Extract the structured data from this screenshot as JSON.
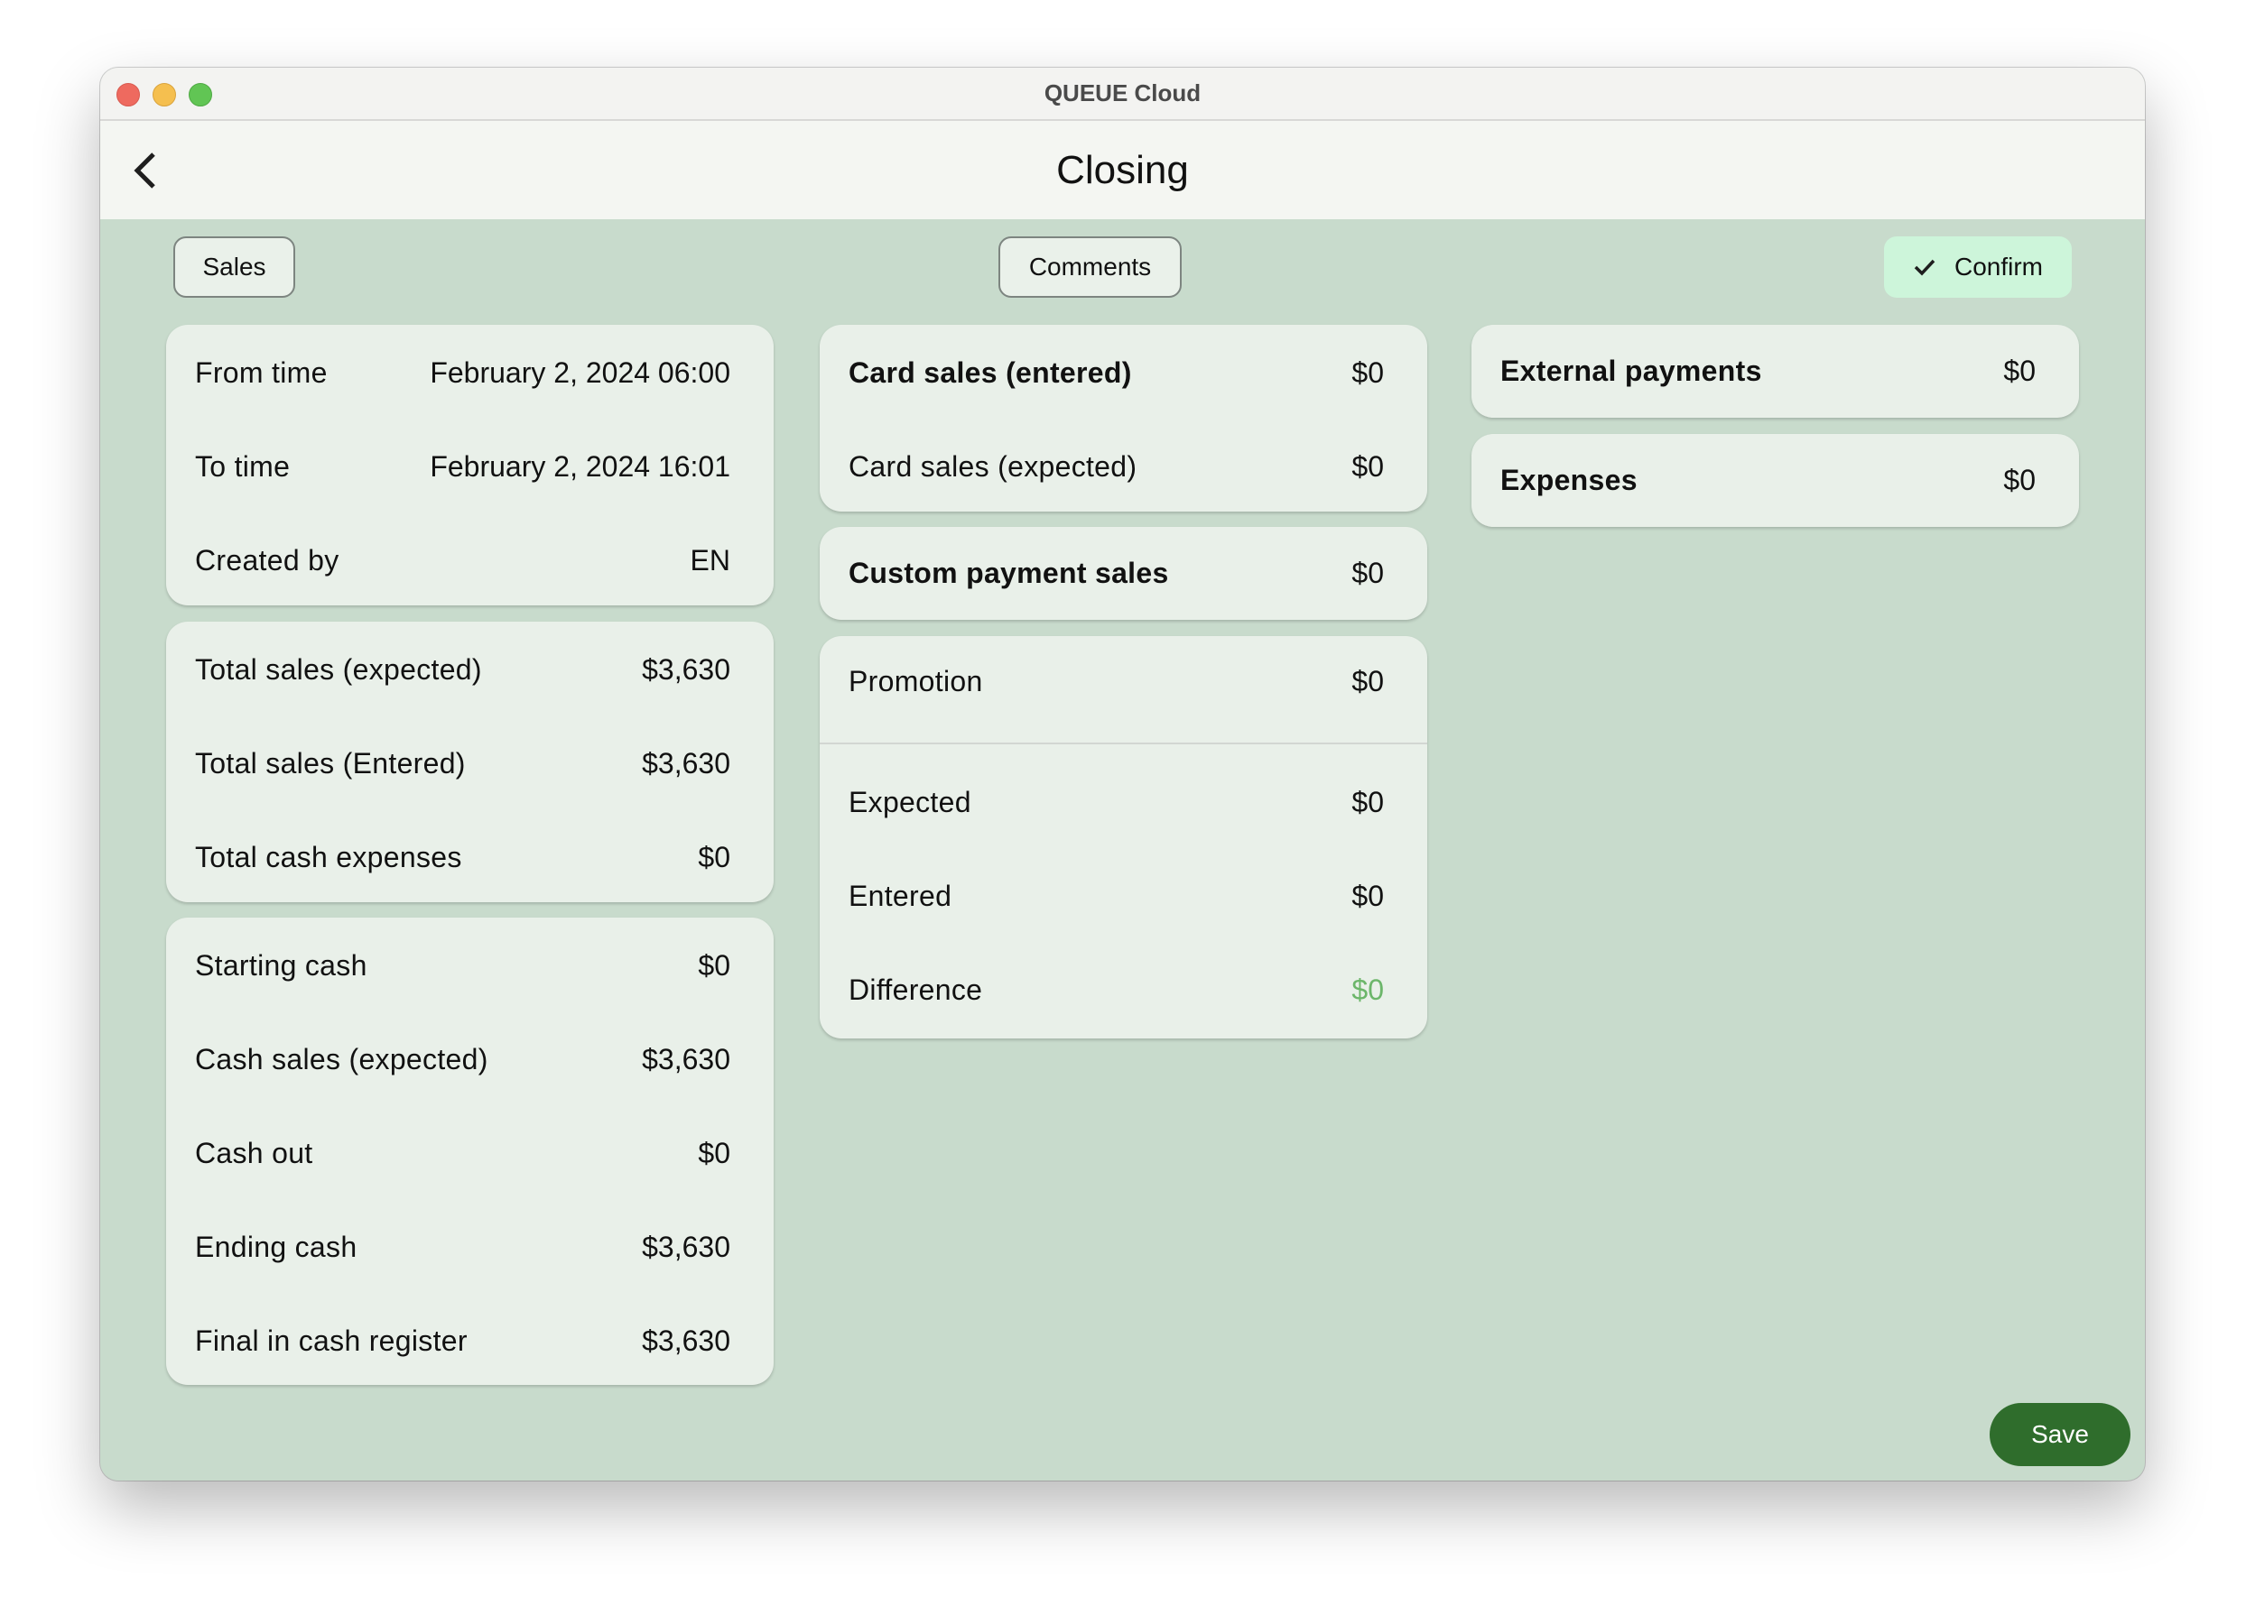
{
  "window": {
    "title": "QUEUE Cloud"
  },
  "header": {
    "title": "Closing",
    "back_icon": "chevron-left-icon"
  },
  "toolbar": {
    "sales_label": "Sales",
    "comments_label": "Comments",
    "confirm_label": "Confirm",
    "confirm_icon": "check-icon"
  },
  "left": {
    "info": [
      {
        "label": "From time",
        "value": "February 2, 2024 06:00"
      },
      {
        "label": "To time",
        "value": "February 2, 2024 16:01"
      },
      {
        "label": "Created by",
        "value": "EN"
      }
    ],
    "totals": [
      {
        "label": "Total sales (expected)",
        "value": "$3,630"
      },
      {
        "label": "Total sales (Entered)",
        "value": "$3,630"
      },
      {
        "label": "Total cash expenses",
        "value": "$0"
      }
    ],
    "cash": [
      {
        "label": "Starting cash",
        "value": "$0"
      },
      {
        "label": "Cash sales (expected)",
        "value": "$3,630"
      },
      {
        "label": "Cash out",
        "value": "$0"
      },
      {
        "label": "Ending cash",
        "value": "$3,630"
      },
      {
        "label": "Final in cash register",
        "value": "$3,630"
      }
    ]
  },
  "middle": {
    "card_sales": [
      {
        "label": "Card sales (entered)",
        "value": "$0"
      },
      {
        "label": "Card sales (expected)",
        "value": "$0"
      }
    ],
    "custom_payment": {
      "label": "Custom payment sales",
      "value": "$0"
    },
    "promotion": {
      "header": {
        "label": "Promotion",
        "value": "$0"
      },
      "rows": [
        {
          "label": "Expected",
          "value": "$0"
        },
        {
          "label": "Entered",
          "value": "$0"
        },
        {
          "label": "Difference",
          "value": "$0"
        }
      ]
    }
  },
  "right": {
    "external_payments": {
      "label": "External payments",
      "value": "$0"
    },
    "expenses": {
      "label": "Expenses",
      "value": "$0"
    }
  },
  "footer": {
    "save_label": "Save"
  },
  "colors": {
    "background": "#c8dbcc",
    "card": "#e9f0e9",
    "confirm": "#cdf5da",
    "save": "#2f6d2c",
    "difference_positive": "#6cb66a"
  }
}
